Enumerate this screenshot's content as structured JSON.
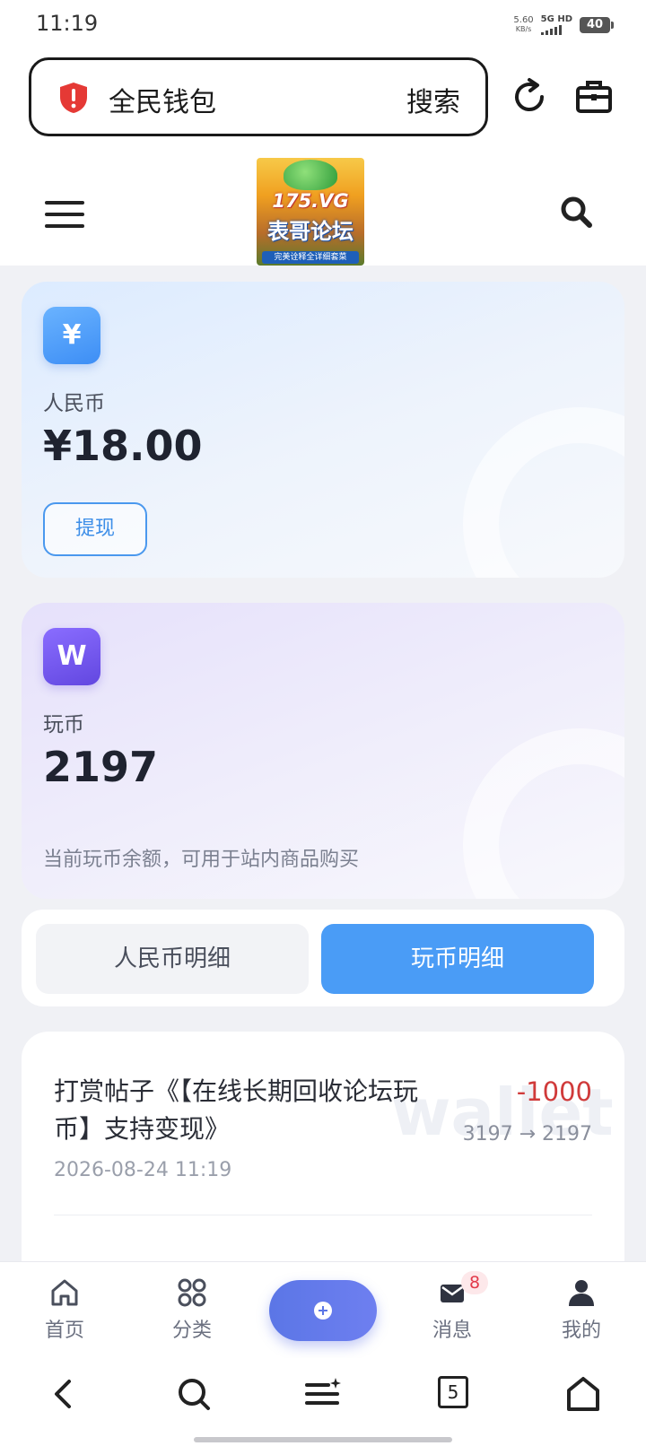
{
  "status_bar": {
    "time": "11:19",
    "net_speed_value": "5.60",
    "net_speed_unit": "KB/s",
    "network_type": "5G HD",
    "battery": "40"
  },
  "browser": {
    "address_text": "全民钱包",
    "search_label": "搜索"
  },
  "site": {
    "logo_text_top": "175.VG",
    "logo_text_main": "表哥论坛",
    "logo_text_sub": "完美诠释全详细套菜"
  },
  "wallet": {
    "rmb": {
      "icon_symbol": "¥",
      "label": "人民币",
      "amount": "¥18.00",
      "withdraw_label": "提现"
    },
    "coin": {
      "icon_symbol": "W",
      "label": "玩币",
      "amount": "2197",
      "note": "当前玩币余额，可用于站内商品购买"
    }
  },
  "tabs": {
    "rmb_detail": "人民币明细",
    "coin_detail": "玩币明细",
    "active": "coin_detail"
  },
  "records": {
    "watermark": "wallet",
    "items": [
      {
        "title": "打赏帖子《【在线长期回收论坛玩币】支持变现》",
        "amount": "-1000",
        "change": "3197 → 2197",
        "time": "2026-08-24 11:19"
      }
    ]
  },
  "app_tabbar": {
    "home": "首页",
    "category": "分类",
    "messages": "消息",
    "messages_badge": "8",
    "mine": "我的"
  },
  "system_nav": {
    "tab_count": "5"
  },
  "colors": {
    "accent_blue": "#4a9cf6",
    "coin_purple": "#6247e0",
    "negative_red": "#d03a3a",
    "fab_blue": "#5b76e6"
  }
}
